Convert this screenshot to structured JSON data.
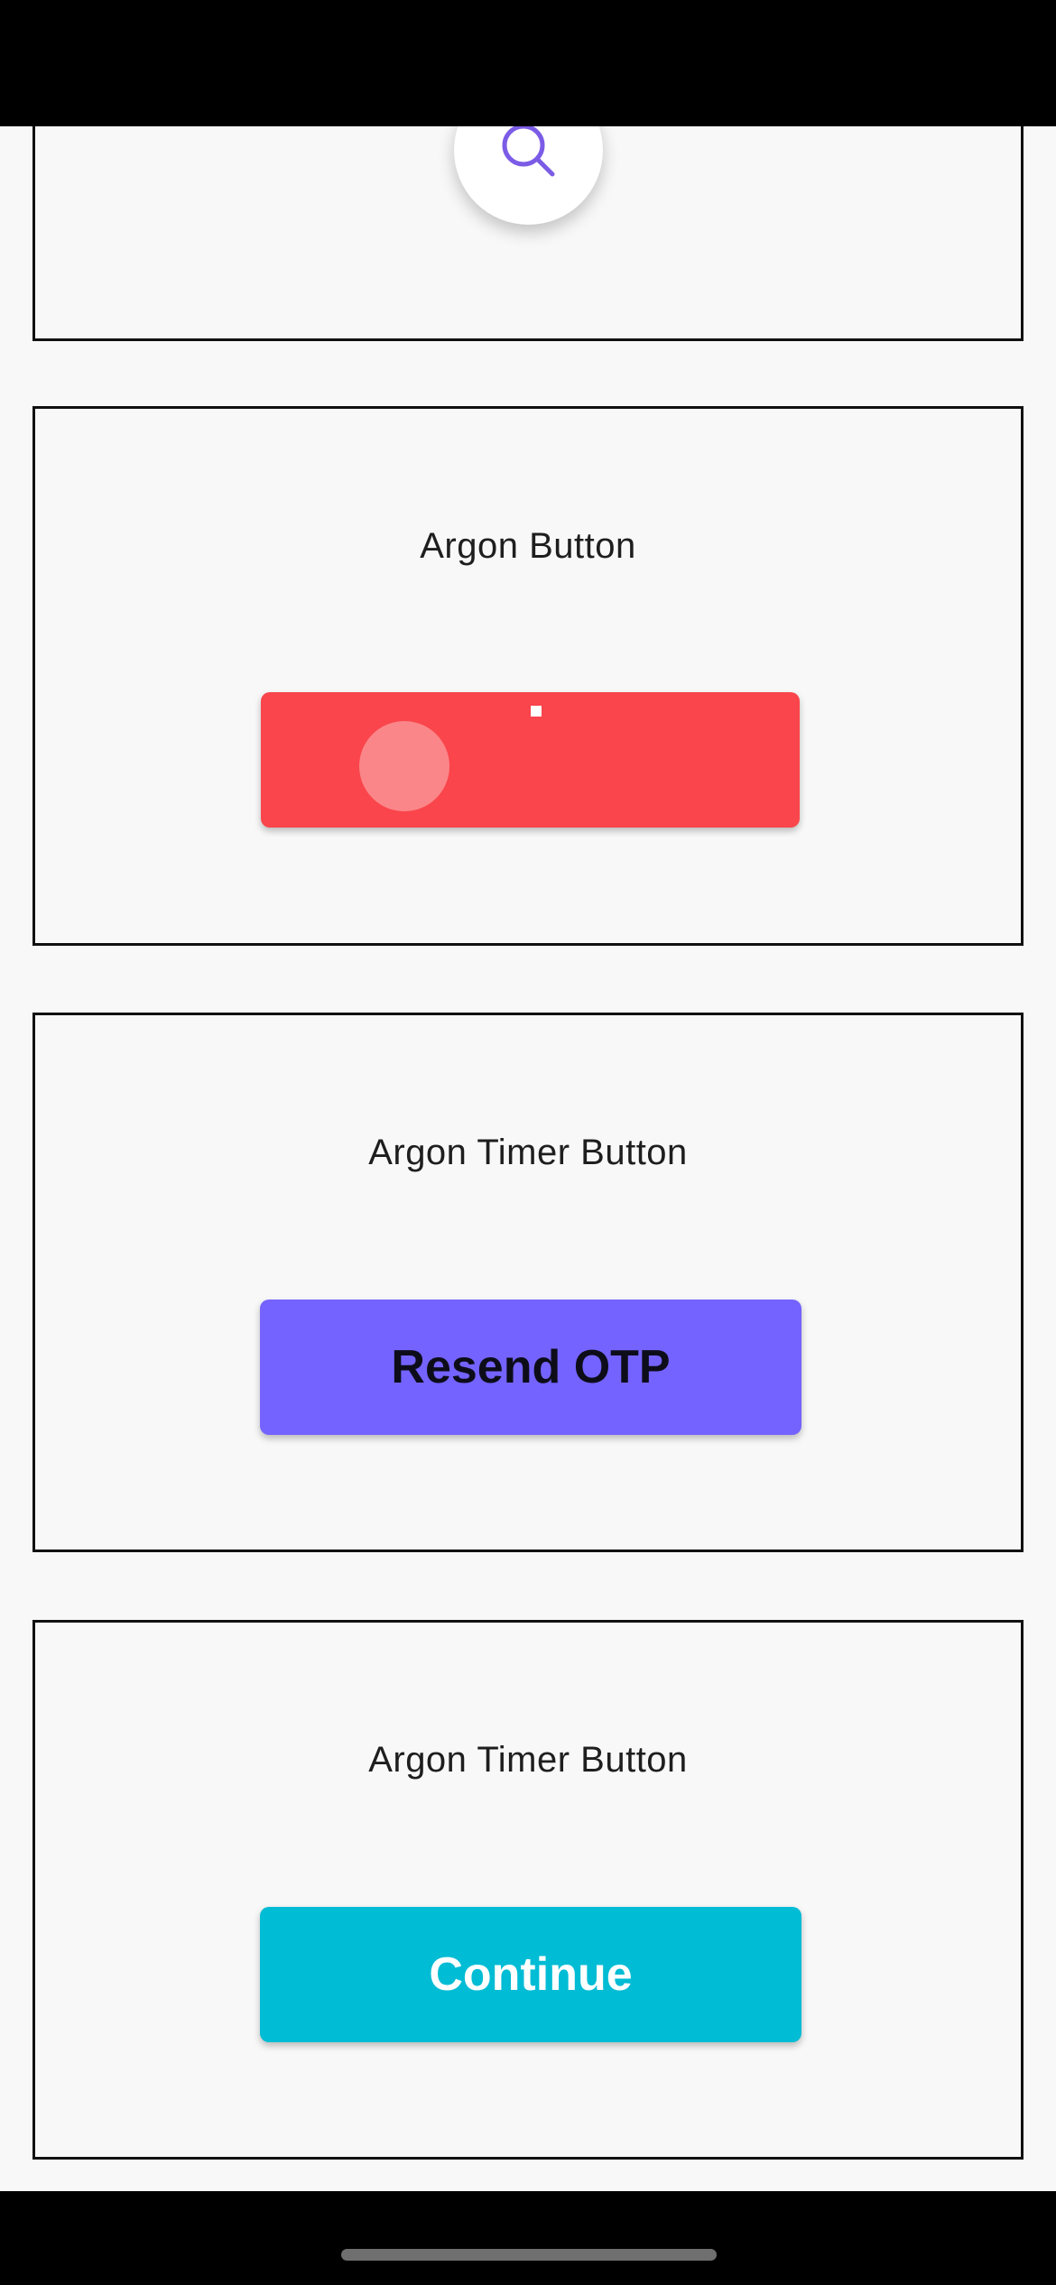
{
  "colors": {
    "argon_button": "#f9454b",
    "timer_button_1": "#7463ff",
    "timer_button_2": "#00bcd4",
    "fab_icon": "#7b5ce6"
  },
  "fab": {
    "icon": "search-icon"
  },
  "cards": [
    {
      "title": "Argon Button",
      "button_label": ""
    },
    {
      "title": "Argon Timer Button",
      "button_label": "Resend OTP"
    },
    {
      "title": "Argon Timer Button",
      "button_label": "Continue"
    }
  ]
}
